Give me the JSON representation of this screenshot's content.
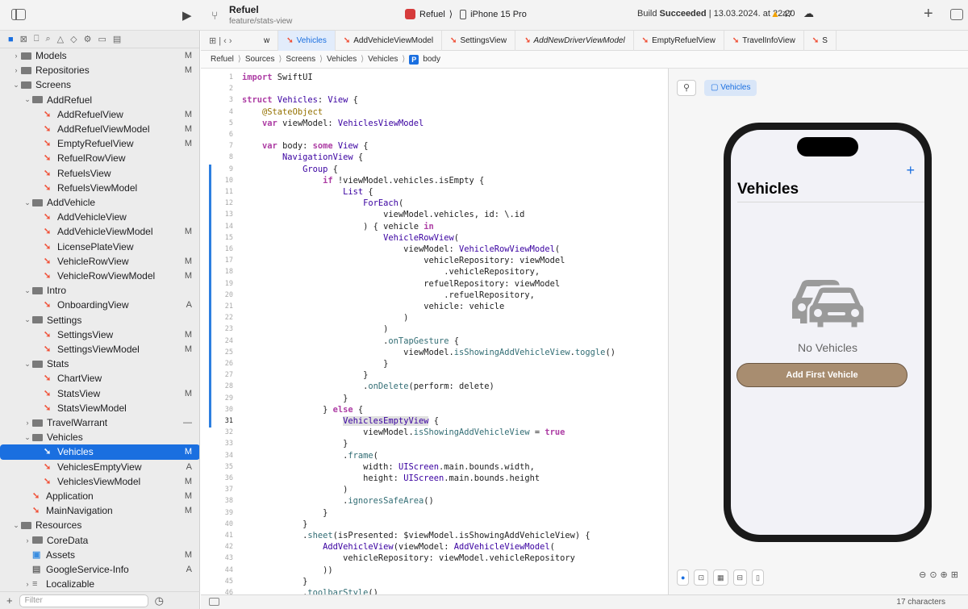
{
  "window": {
    "project": "Refuel",
    "branch": "feature/stats-view",
    "scheme": "Refuel",
    "device": "iPhone 15 Pro",
    "build_prefix": "Build",
    "build_status": "Succeeded",
    "build_time": "| 13.03.2024. at 22:20",
    "warnings": "47",
    "add": "+"
  },
  "navigator": {
    "filter_placeholder": "Filter",
    "rows": [
      {
        "label": "Models",
        "type": "folder",
        "depth": 1,
        "open": false,
        "status": "M"
      },
      {
        "label": "Repositories",
        "type": "folder",
        "depth": 1,
        "open": false,
        "status": "M"
      },
      {
        "label": "Screens",
        "type": "folder",
        "depth": 1,
        "open": true,
        "status": ""
      },
      {
        "label": "AddRefuel",
        "type": "folder",
        "depth": 2,
        "open": true,
        "status": ""
      },
      {
        "label": "AddRefuelView",
        "type": "swift",
        "depth": 3,
        "status": "M"
      },
      {
        "label": "AddRefuelViewModel",
        "type": "swift",
        "depth": 3,
        "status": "M"
      },
      {
        "label": "EmptyRefuelView",
        "type": "swift",
        "depth": 3,
        "status": "M"
      },
      {
        "label": "RefuelRowView",
        "type": "swift",
        "depth": 3,
        "status": ""
      },
      {
        "label": "RefuelsView",
        "type": "swift",
        "depth": 3,
        "status": ""
      },
      {
        "label": "RefuelsViewModel",
        "type": "swift",
        "depth": 3,
        "status": ""
      },
      {
        "label": "AddVehicle",
        "type": "folder",
        "depth": 2,
        "open": true,
        "status": ""
      },
      {
        "label": "AddVehicleView",
        "type": "swift",
        "depth": 3,
        "status": ""
      },
      {
        "label": "AddVehicleViewModel",
        "type": "swift",
        "depth": 3,
        "status": "M"
      },
      {
        "label": "LicensePlateView",
        "type": "swift",
        "depth": 3,
        "status": ""
      },
      {
        "label": "VehicleRowView",
        "type": "swift",
        "depth": 3,
        "status": "M"
      },
      {
        "label": "VehicleRowViewModel",
        "type": "swift",
        "depth": 3,
        "status": "M"
      },
      {
        "label": "Intro",
        "type": "folder",
        "depth": 2,
        "open": true,
        "status": ""
      },
      {
        "label": "OnboardingView",
        "type": "swift",
        "depth": 3,
        "status": "A"
      },
      {
        "label": "Settings",
        "type": "folder",
        "depth": 2,
        "open": true,
        "status": ""
      },
      {
        "label": "SettingsView",
        "type": "swift",
        "depth": 3,
        "status": "M"
      },
      {
        "label": "SettingsViewModel",
        "type": "swift",
        "depth": 3,
        "status": "M"
      },
      {
        "label": "Stats",
        "type": "folder",
        "depth": 2,
        "open": true,
        "status": ""
      },
      {
        "label": "ChartView",
        "type": "swift",
        "depth": 3,
        "status": ""
      },
      {
        "label": "StatsView",
        "type": "swift",
        "depth": 3,
        "status": "M"
      },
      {
        "label": "StatsViewModel",
        "type": "swift",
        "depth": 3,
        "status": ""
      },
      {
        "label": "TravelWarrant",
        "type": "folder",
        "depth": 2,
        "open": false,
        "status": "—"
      },
      {
        "label": "Vehicles",
        "type": "folder",
        "depth": 2,
        "open": true,
        "status": ""
      },
      {
        "label": "Vehicles",
        "type": "swift",
        "depth": 3,
        "status": "M",
        "selected": true
      },
      {
        "label": "VehiclesEmptyView",
        "type": "swift",
        "depth": 3,
        "status": "A"
      },
      {
        "label": "VehiclesViewModel",
        "type": "swift",
        "depth": 3,
        "status": "M"
      },
      {
        "label": "Application",
        "type": "swift",
        "depth": 2,
        "status": "M"
      },
      {
        "label": "MainNavigation",
        "type": "swift",
        "depth": 2,
        "status": "M"
      },
      {
        "label": "Resources",
        "type": "folder",
        "depth": 1,
        "open": true,
        "status": ""
      },
      {
        "label": "CoreData",
        "type": "folder",
        "depth": 2,
        "open": false,
        "status": ""
      },
      {
        "label": "Assets",
        "type": "asset",
        "depth": 2,
        "status": "M"
      },
      {
        "label": "GoogleService-Info",
        "type": "plist",
        "depth": 2,
        "status": "A"
      },
      {
        "label": "Localizable",
        "type": "strings",
        "depth": 2,
        "open": false,
        "status": ""
      }
    ]
  },
  "tabs": [
    {
      "label": "w",
      "active": false,
      "italic": false
    },
    {
      "label": "Vehicles",
      "active": true,
      "italic": false
    },
    {
      "label": "AddVehicleViewModel",
      "active": false,
      "italic": false
    },
    {
      "label": "SettingsView",
      "active": false,
      "italic": false
    },
    {
      "label": "AddNewDriverViewModel",
      "active": false,
      "italic": true
    },
    {
      "label": "EmptyRefuelView",
      "active": false,
      "italic": false
    },
    {
      "label": "TravelInfoView",
      "active": false,
      "italic": false
    },
    {
      "label": "S",
      "active": false,
      "italic": false
    }
  ],
  "breadcrumb": [
    "Refuel",
    "Sources",
    "Screens",
    "Vehicles",
    "Vehicles",
    "body"
  ],
  "code_lines": [
    "<span class=\"kw\">import</span> SwiftUI",
    "",
    "<span class=\"kw\">struct</span> <span class=\"ty\">Vehicles</span>: <span class=\"ty\">View</span> {",
    "    <span class=\"at\">@StateObject</span>",
    "    <span class=\"kw\">var</span> viewModel: <span class=\"ty\">VehiclesViewModel</span>",
    "",
    "    <span class=\"kw\">var</span> body: <span class=\"kw\">some</span> <span class=\"ty\">View</span> {",
    "        <span class=\"ty\">NavigationView</span> {",
    "            <span class=\"ty\">Group</span> {",
    "                <span class=\"kw\">if</span> !viewModel.vehicles.isEmpty {",
    "                    <span class=\"ty\">List</span> {",
    "                        <span class=\"ty\">ForEach</span>(",
    "                            viewModel.vehicles, id: \\.id",
    "                        ) { vehicle <span class=\"kw\">in</span>",
    "                            <span class=\"ty\">VehicleRowView</span>(",
    "                                viewModel: <span class=\"ty\">VehicleRowViewModel</span>(",
    "                                    vehicleRepository: viewModel",
    "                                        .vehicleRepository,",
    "                                    refuelRepository: viewModel",
    "                                        .refuelRepository,",
    "                                    vehicle: vehicle",
    "                                )",
    "                            )",
    "                            .<span class=\"fn\">onTapGesture</span> {",
    "                                viewModel.<span class=\"fn\">isShowingAddVehicleView</span>.<span class=\"fn\">toggle</span>()",
    "                            }",
    "                        }",
    "                        .<span class=\"fn\">onDelete</span>(perform: delete)",
    "                    }",
    "                } <span class=\"kw\">else</span> {",
    "                    <span class=\"ty hl\">VehiclesEmptyView</span> {",
    "                        viewModel.<span class=\"fn\">isShowingAddVehicleView</span> = <span class=\"kw\">true</span>",
    "                    }",
    "                    .<span class=\"fn\">frame</span>(",
    "                        width: <span class=\"ty\">UIScreen</span>.main.bounds.width,",
    "                        height: <span class=\"ty\">UIScreen</span>.main.bounds.height",
    "                    )",
    "                    .<span class=\"fn\">ignoresSafeArea</span>()",
    "                }",
    "            }",
    "            .<span class=\"fn\">sheet</span>(isPresented: $viewModel.isShowingAddVehicleView) {",
    "                <span class=\"ty\">AddVehicleView</span>(viewModel: <span class=\"ty\">AddVehicleViewModel</span>(",
    "                    vehicleRepository: viewModel.vehicleRepository",
    "                ))",
    "            }",
    "            .<span class=\"fn\">toolbarStyle</span>()"
  ],
  "canvas": {
    "tab_label": "Vehicles",
    "app_title": "Vehicles",
    "add_symbol": "+",
    "empty_text": "No Vehicles",
    "button_label": "Add First Vehicle"
  },
  "status": {
    "chars": "17 characters"
  },
  "colors": {
    "accent": "#1a6fe0",
    "button": "#a88d70",
    "swift": "#f05138"
  }
}
